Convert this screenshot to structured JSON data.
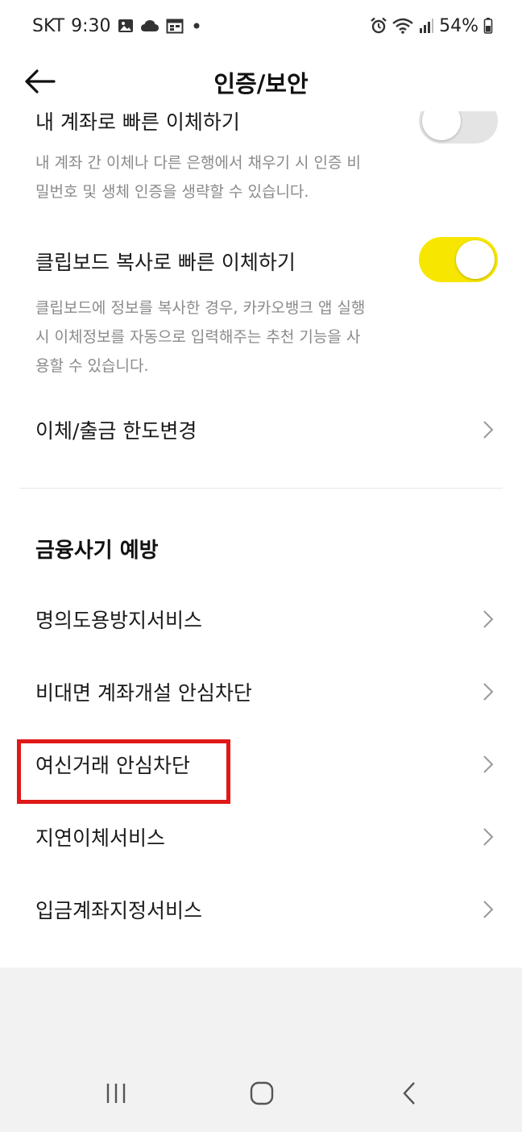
{
  "status_bar": {
    "carrier": "SKT",
    "time": "9:30",
    "battery": "54%",
    "notification_icons": [
      "image-icon",
      "cloud-icon",
      "calendar-icon",
      "dot-icon"
    ],
    "system_icons": [
      "alarm-icon",
      "wifi-icon",
      "signal-icon",
      "battery-icon"
    ]
  },
  "header": {
    "title": "인증/보안",
    "back_icon": "arrow-left-icon"
  },
  "toggles": [
    {
      "title": "내 계좌로 빠른 이체하기",
      "description": "내 계좌 간 이체나 다른 은행에서 채우기 시 인증 비밀번호 및 생체 인증을 생략할 수 있습니다.",
      "state": "off"
    },
    {
      "title": "클립보드 복사로 빠른 이체하기",
      "description": "클립보드에 정보를 복사한 경우, 카카오뱅크 앱 실행 시 이체정보를 자동으로 입력해주는 추천 기능을 사용할 수 있습니다.",
      "state": "on"
    }
  ],
  "limit_item": {
    "label": "이체/출금 한도변경"
  },
  "section": {
    "title": "금융사기 예방",
    "items": [
      {
        "label": "명의도용방지서비스"
      },
      {
        "label": "비대면 계좌개설 안심차단"
      },
      {
        "label": "여신거래 안심차단"
      },
      {
        "label": "지연이체서비스"
      },
      {
        "label": "입금계좌지정서비스"
      }
    ]
  },
  "nav_bar": [
    "recent-apps-icon",
    "home-icon",
    "back-icon"
  ],
  "colors": {
    "toggle_on": "#f7e600",
    "toggle_off": "#e4e4e4",
    "highlight": "#e01818",
    "description_text": "#8a8a8a"
  }
}
